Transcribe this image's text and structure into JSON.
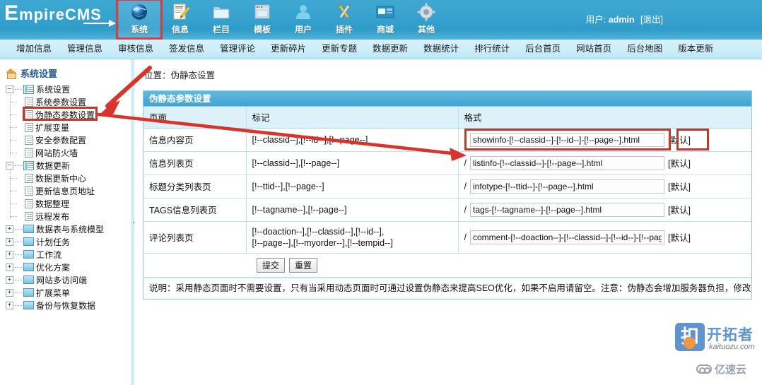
{
  "brand": {
    "logo_prefix": "E",
    "logo_rest": "mpireCMS",
    "arrow_icon": "right-arrow-icon"
  },
  "topnav": {
    "items": [
      {
        "label": "系统",
        "icon": "globe-icon",
        "selected": true
      },
      {
        "label": "信息",
        "icon": "note-pencil-icon",
        "selected": false
      },
      {
        "label": "栏目",
        "icon": "folder-icon",
        "selected": false
      },
      {
        "label": "模板",
        "icon": "window-icon",
        "selected": false
      },
      {
        "label": "用户",
        "icon": "person-icon",
        "selected": false
      },
      {
        "label": "插件",
        "icon": "tools-icon",
        "selected": false
      },
      {
        "label": "商城",
        "icon": "credit-card-icon",
        "selected": false
      },
      {
        "label": "其他",
        "icon": "gear-icon",
        "selected": false
      }
    ],
    "user_label": "用户:",
    "user_name": "admin",
    "logout_label": "[退出]"
  },
  "subnav": {
    "items": [
      "增加信息",
      "管理信息",
      "审核信息",
      "签发信息",
      "管理评论",
      "更新碎片",
      "更新专题",
      "数据更新",
      "数据统计",
      "排行统计",
      "后台首页",
      "网站首页",
      "后台地图",
      "版本更新"
    ]
  },
  "sidebar": {
    "title": "系统设置",
    "title_icon": "home-icon",
    "groups": [
      {
        "label": "系统设置",
        "expanded": true,
        "icon": "list-icon",
        "children": [
          {
            "label": "系统参数设置",
            "icon": "sheet-icon",
            "highlighted": false
          },
          {
            "label": "伪静态参数设置",
            "icon": "sheet-icon",
            "highlighted": true
          },
          {
            "label": "扩展变量",
            "icon": "sheet-icon",
            "highlighted": false
          },
          {
            "label": "安全参数配置",
            "icon": "sheet-icon",
            "highlighted": false
          },
          {
            "label": "网站防火墙",
            "icon": "sheet-icon",
            "highlighted": false
          }
        ]
      },
      {
        "label": "数据更新",
        "expanded": true,
        "icon": "list-icon",
        "children": [
          {
            "label": "数据更新中心",
            "icon": "sheet-icon",
            "highlighted": false
          },
          {
            "label": "更新信息页地址",
            "icon": "sheet-icon",
            "highlighted": false
          },
          {
            "label": "数据整理",
            "icon": "sheet-icon",
            "highlighted": false
          },
          {
            "label": "远程发布",
            "icon": "sheet-icon",
            "highlighted": false
          }
        ]
      }
    ],
    "collapsed_groups": [
      {
        "label": "数据表与系统模型",
        "icon": "folder-icon"
      },
      {
        "label": "计划任务",
        "icon": "folder-icon"
      },
      {
        "label": "工作流",
        "icon": "folder-icon"
      },
      {
        "label": "优化方案",
        "icon": "folder-icon"
      },
      {
        "label": "网站多访问端",
        "icon": "folder-icon"
      },
      {
        "label": "扩展菜单",
        "icon": "folder-icon"
      },
      {
        "label": "备份与恢复数据",
        "icon": "folder-icon"
      }
    ],
    "collapse_handle_icon": "chevron-left-icon"
  },
  "content": {
    "breadcrumb": "位置：伪静态设置",
    "panel_title": "伪静态参数设置",
    "columns": [
      "页面",
      "标记",
      "格式"
    ],
    "rows": [
      {
        "page": "信息内容页",
        "mark": "[!--classid--],[!--id--],[!--page--]",
        "mark2": "",
        "slash": "/",
        "value": "showinfo-[!--classid--]-[!--id--]-[!--page--].html",
        "default_label": "[默认]",
        "highlighted": true
      },
      {
        "page": "信息列表页",
        "mark": "[!--classid--],[!--page--]",
        "mark2": "",
        "slash": "/",
        "value": "listinfo-[!--classid--]-[!--page--].html",
        "default_label": "[默认]",
        "highlighted": false
      },
      {
        "page": "标题分类列表页",
        "mark": "[!--ttid--],[!--page--]",
        "mark2": "",
        "slash": "/",
        "value": "infotype-[!--ttid--]-[!--page--].html",
        "default_label": "[默认]",
        "highlighted": false
      },
      {
        "page": "TAGS信息列表页",
        "mark": "[!--tagname--],[!--page--]",
        "mark2": "",
        "slash": "/",
        "value": "tags-[!--tagname--]-[!--page--].html",
        "default_label": "[默认]",
        "highlighted": false
      },
      {
        "page": "评论列表页",
        "mark": "[!--doaction--],[!--classid--],[!--id--],",
        "mark2": "[!--page--],[!--myorder--],[!--tempid--]",
        "slash": "/",
        "value": "comment-[!--doaction--]-[!--classid--]-[!--id--]-[!--page--",
        "default_label": "[默认]",
        "highlighted": false
      }
    ],
    "submit_label": "提交",
    "reset_label": "重置",
    "note": "说明：采用静态页面时不需要设置，只有当采用动态页面时可通过设置伪静态来提高SEO优化，如果不启用请留空。注意：伪静态会增加服务器负担，修改伪静态格"
  },
  "watermarks": {
    "kaituozu_cn": "开拓者",
    "kaituozu_en": "kaituozu.com",
    "yisuyun": "亿速云"
  },
  "colors": {
    "brand_blue": "#38a3cf",
    "subnav_blue": "#cdeefa",
    "panel_head": "#3fa5d2",
    "annotation_red": "#c0392b",
    "th_bg": "#ddf1fb"
  }
}
